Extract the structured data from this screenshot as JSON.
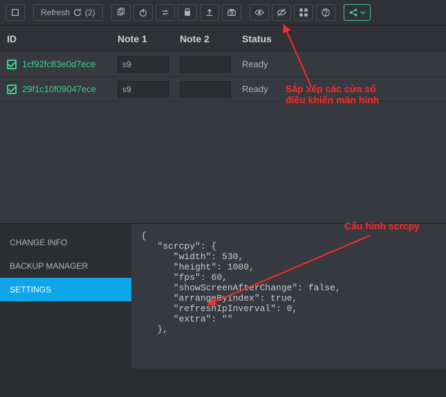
{
  "toolbar": {
    "refresh_label": "Refresh",
    "refresh_count": "(2)"
  },
  "table": {
    "headers": {
      "id": "ID",
      "note1": "Note 1",
      "note2": "Note 2",
      "status": "Status"
    },
    "rows": [
      {
        "id": "1cf92fc83e0d7ece",
        "note1": "s9",
        "note2": "",
        "status": "Ready"
      },
      {
        "id": "29f1c10f09047ece",
        "note1": "s9",
        "note2": "",
        "status": "Ready"
      }
    ]
  },
  "sidebar": {
    "items": [
      {
        "label": "CHANGE INFO"
      },
      {
        "label": "BACKUP MANAGER"
      },
      {
        "label": "SETTINGS"
      }
    ]
  },
  "settings_code": "{\n   \"scrcpy\": {\n      \"width\": 530,\n      \"height\": 1000,\n      \"fps\": 60,\n      \"showScreenAfterChange\": false,\n      \"arrangeByIndex\": true,\n      \"refreshIpInverval\": 0,\n      \"extra\": \"\"\n   },",
  "annotations": {
    "a1": "Sắp xếp các cửa sổ\nđiều khiển màn hình",
    "a2": "Cấu hình scrcpy"
  }
}
